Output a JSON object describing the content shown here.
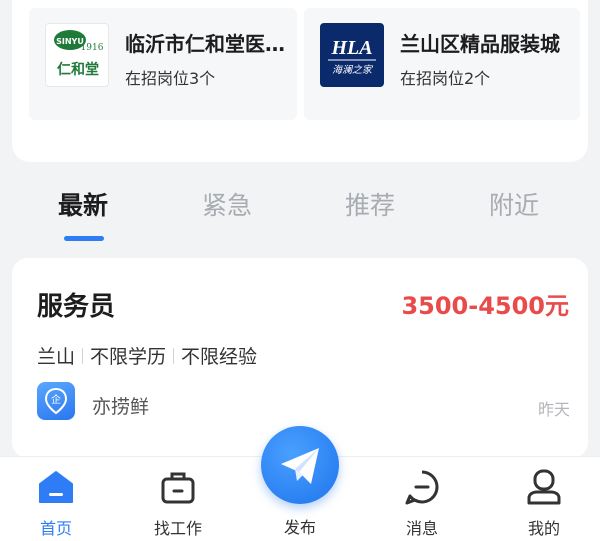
{
  "companies": [
    {
      "name": "临沂市仁和堂医…",
      "positions": "在招岗位3个",
      "logo_text": "仁和堂",
      "logo_small": "1916",
      "logo_brand": "SINYU"
    },
    {
      "name": "兰山区精品服装城",
      "positions": "在招岗位2个",
      "logo_text": "HLA",
      "logo_sub": "海澜之家"
    }
  ],
  "tabs": [
    {
      "label": "最新"
    },
    {
      "label": "紧急"
    },
    {
      "label": "推荐"
    },
    {
      "label": "附近"
    }
  ],
  "job": {
    "title": "服务员",
    "salary": "3500-4500元",
    "tags": [
      "兰山",
      "不限学历",
      "不限经验"
    ],
    "employer_icon_text": "企",
    "employer": "亦捞鲜",
    "posted": "昨天"
  },
  "nav": {
    "home": "首页",
    "find_job": "找工作",
    "publish": "发布",
    "messages": "消息",
    "mine": "我的"
  },
  "colors": {
    "accent": "#2f7df6",
    "salary": "#e94b4b",
    "hla_bg": "#0b2a6b",
    "renhe_green": "#1f7a3a"
  },
  "icons": {
    "home": "home-icon",
    "find_job": "briefcase-icon",
    "publish": "paper-plane-icon",
    "messages": "chat-bubble-icon",
    "mine": "user-icon",
    "employer": "company-badge-icon"
  }
}
